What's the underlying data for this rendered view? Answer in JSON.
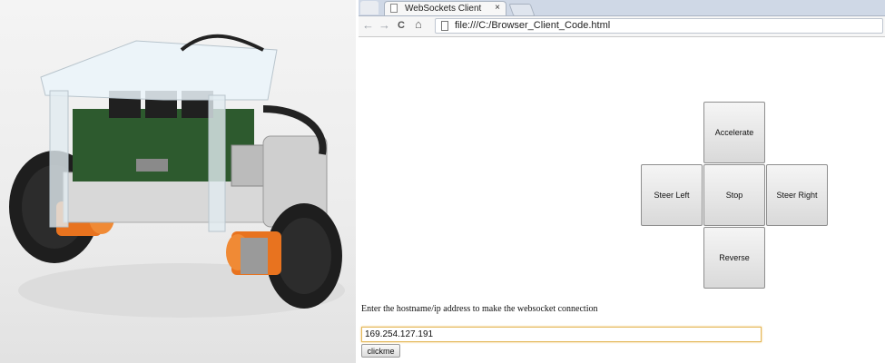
{
  "browser": {
    "tab_title": "WebSockets Client",
    "tab_close": "×",
    "url": "file:///C:/Browser_Client_Code.html",
    "nav": {
      "back": "←",
      "forward": "→",
      "reload": "C",
      "home": "⌂"
    }
  },
  "controls": {
    "accelerate": "Accelerate",
    "steer_left": "Steer Left",
    "stop": "Stop",
    "steer_right": "Steer Right",
    "reverse": "Reverse"
  },
  "connection": {
    "prompt": "Enter the hostname/ip address to make the websocket connection",
    "host_value": "169.254.127.191",
    "submit_label": "clickme"
  },
  "colors": {
    "tabbar": "#cfd8e6",
    "input_focus": "#e4b85a",
    "button_border": "#8e8e8e"
  }
}
